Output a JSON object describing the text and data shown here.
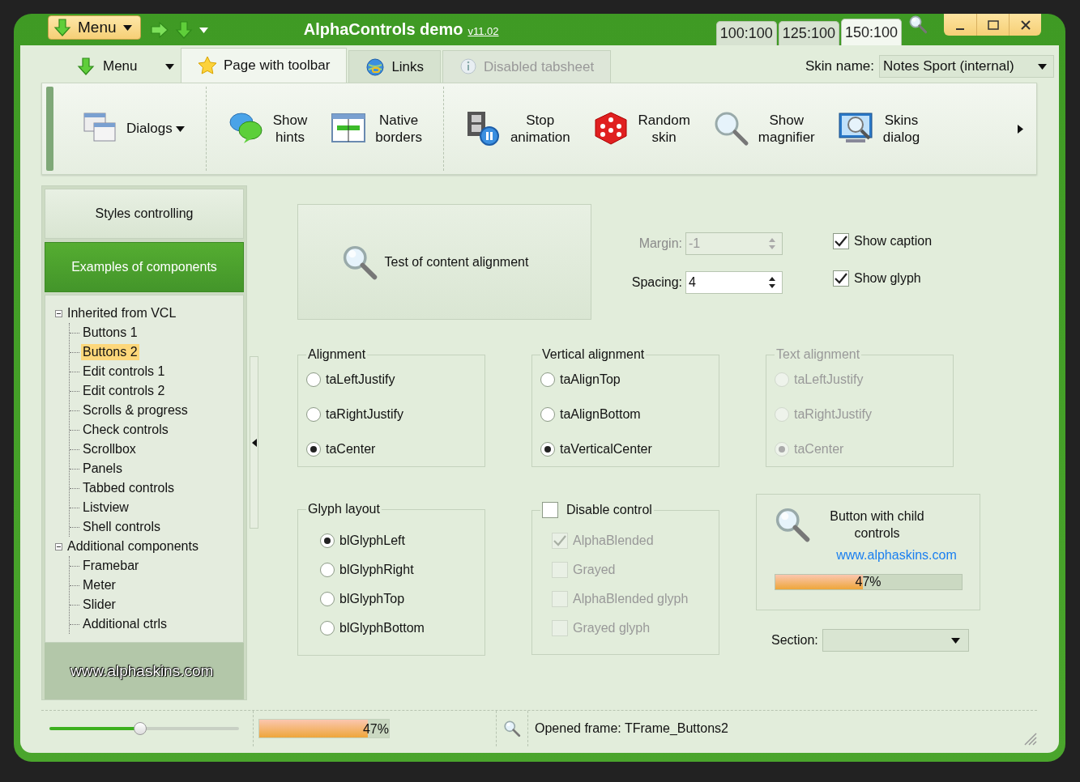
{
  "title_bar": {
    "menu_button": "Menu",
    "title": "AlphaControls demo",
    "version": "v11.02",
    "scale_tabs": [
      {
        "label": "100:100",
        "selected": false
      },
      {
        "label": "125:100",
        "selected": false
      },
      {
        "label": "150:100",
        "selected": true
      }
    ]
  },
  "menu_button": "Menu",
  "tabs": [
    {
      "label": "Page with toolbar",
      "selected": true,
      "disabled": false
    },
    {
      "label": "Links",
      "selected": false,
      "disabled": false
    },
    {
      "label": "Disabled tabsheet",
      "selected": false,
      "disabled": true
    }
  ],
  "skin_selector": {
    "label": "Skin name:",
    "value": "Notes Sport (internal)"
  },
  "toolbar": [
    {
      "items": [
        {
          "label": "Dialogs",
          "kind": "dropdown"
        }
      ]
    },
    {
      "items": [
        {
          "label": "Show hints",
          "kind": "button"
        },
        {
          "label": "Native borders",
          "kind": "button"
        }
      ]
    },
    {
      "items": [
        {
          "label": "Stop animation",
          "kind": "button"
        },
        {
          "label": "Random skin",
          "kind": "button"
        },
        {
          "label": "Show magnifier",
          "kind": "button"
        },
        {
          "label": "Skins dialog",
          "kind": "button"
        }
      ]
    }
  ],
  "sidebar": {
    "sections": [
      {
        "label": "Styles controlling",
        "selected": false
      },
      {
        "label": "Examples of components",
        "selected": true
      }
    ],
    "tree": [
      {
        "label": "Inherited from VCL",
        "expanded": true,
        "selected": false,
        "children": [
          {
            "label": "Buttons 1",
            "selected": false
          },
          {
            "label": "Buttons 2",
            "selected": true
          },
          {
            "label": "Edit controls 1",
            "selected": false
          },
          {
            "label": "Edit controls 2",
            "selected": false
          },
          {
            "label": "Scrolls & progress",
            "selected": false
          },
          {
            "label": "Check controls",
            "selected": false
          },
          {
            "label": "Scrollbox",
            "selected": false
          },
          {
            "label": "Panels",
            "selected": false
          },
          {
            "label": "Tabbed controls",
            "selected": false
          },
          {
            "label": "Listview",
            "selected": false
          },
          {
            "label": "Shell controls",
            "selected": false
          }
        ]
      },
      {
        "label": "Additional components",
        "expanded": true,
        "selected": false,
        "children": [
          {
            "label": "Framebar",
            "selected": false
          },
          {
            "label": "Meter",
            "selected": false
          },
          {
            "label": "Slider",
            "selected": false
          },
          {
            "label": "Additional ctrls",
            "selected": false
          }
        ]
      }
    ],
    "footer": "www.alphaskins.com"
  },
  "content": {
    "alignment_button": "Test of content alignment",
    "spin_fields": [
      {
        "label": "Margin:",
        "value": "-1",
        "disabled": true
      },
      {
        "label": "Spacing:",
        "value": "4",
        "disabled": false
      }
    ],
    "options": [
      {
        "label": "Show caption",
        "checked": true
      },
      {
        "label": "Show glyph",
        "checked": true
      }
    ],
    "radio_groups": [
      {
        "title": "Alignment",
        "disabled": false,
        "options": [
          {
            "label": "taLeftJustify",
            "selected": false
          },
          {
            "label": "taRightJustify",
            "selected": false
          },
          {
            "label": "taCenter",
            "selected": true
          }
        ]
      },
      {
        "title": "Vertical alignment",
        "disabled": false,
        "options": [
          {
            "label": "taAlignTop",
            "selected": false
          },
          {
            "label": "taAlignBottom",
            "selected": false
          },
          {
            "label": "taVerticalCenter",
            "selected": true
          }
        ]
      },
      {
        "title": "Text alignment",
        "disabled": true,
        "options": [
          {
            "label": "taLeftJustify",
            "selected": false
          },
          {
            "label": "taRightJustify",
            "selected": false
          },
          {
            "label": "taCenter",
            "selected": true
          }
        ]
      }
    ],
    "glyph_layout": {
      "title": "Glyph layout",
      "disabled": false,
      "options": [
        {
          "label": "blGlyphLeft",
          "selected": true
        },
        {
          "label": "blGlyphRight",
          "selected": false
        },
        {
          "label": "blGlyphTop",
          "selected": false
        },
        {
          "label": "blGlyphBottom",
          "selected": false
        }
      ]
    },
    "disable_control": {
      "label": "Disable control",
      "checked": false,
      "options": [
        {
          "label": "AlphaBlended",
          "checked": true,
          "disabled": true
        },
        {
          "label": "Grayed",
          "checked": false,
          "disabled": true
        },
        {
          "label": "AlphaBlended glyph",
          "checked": false,
          "disabled": true
        },
        {
          "label": "Grayed glyph",
          "checked": false,
          "disabled": true
        }
      ]
    },
    "child_button": {
      "label": "Button with child controls",
      "link": "www.alphaskins.com",
      "progress": {
        "level": 0.47,
        "reading": "47%"
      }
    },
    "section": {
      "label": "Section:"
    }
  },
  "status_bar": {
    "slider": {
      "level": 0.48
    },
    "progress": {
      "level": 0.84,
      "reading": "47%"
    },
    "text": "Opened frame: TFrame_Buttons2"
  }
}
